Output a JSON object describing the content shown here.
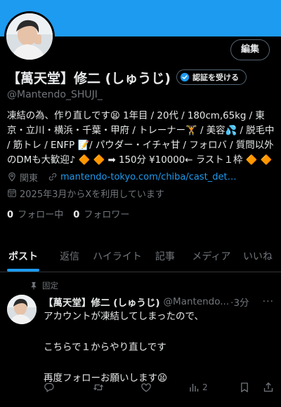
{
  "header": {
    "edit_label": "編集"
  },
  "profile": {
    "display_name": "【萬天堂】修二 (しゅうじ)",
    "verify_label": "認証を受ける",
    "handle": "@Mantendo_SHUJI_",
    "bio": "凍結の為、作り直しです😫 1年目 / 20代 / 180cm,65kg / 東京・立川・横浜・千葉・甲府 / トレーナー🏋 / 美容💦 / 脱毛中 / 筋トレ / ENFP 📝/ パウダー・イチャ甘 / フォロバ / 質問以外のDMも大歓迎♪ 🔶 🔶 ➡ 150分 ¥10000← ラスト１枠 🔶 🔶",
    "location": "関東",
    "link": "mantendo-tokyo.com/chiba/cast_det…",
    "joined": "2025年3月からXを利用しています",
    "following_count": "0",
    "following_label": "フォロー中",
    "followers_count": "0",
    "followers_label": "フォロワー",
    "icons": [
      "location-pin-icon",
      "link-icon",
      "calendar-icon",
      "verified-check-icon"
    ]
  },
  "tabs": [
    {
      "label": "ポスト",
      "active": true
    },
    {
      "label": "返信"
    },
    {
      "label": "ハイライト"
    },
    {
      "label": "記事"
    },
    {
      "label": "メディア"
    },
    {
      "label": "いいね"
    }
  ],
  "tweet": {
    "pinned_label": "固定",
    "author_name": "【萬天堂】修二 (しゅうじ)",
    "author_handle": "@Mantendo...",
    "time": "·3分",
    "more": "···",
    "lines": [
      "アカウントが凍結してしまったので、",
      "",
      "こちらで１からやり直しです",
      "",
      "再度フォローお願いします😫"
    ],
    "actions": {
      "reply": "",
      "retweet": "",
      "like": "",
      "views": "2"
    }
  },
  "colors": {
    "banner": "#1d9bf0",
    "accent": "#1d9bf0",
    "background": "#000000",
    "text": "#e7e9ea",
    "muted": "#71767b"
  }
}
